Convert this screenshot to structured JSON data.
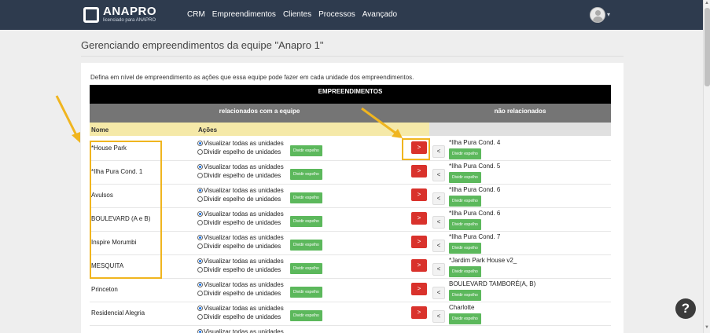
{
  "header": {
    "brand": "ANAPRO",
    "brand_sub": "licenciado para ANAPRO",
    "nav": [
      "CRM",
      "Empreendimentos",
      "Clientes",
      "Processos",
      "Avançado"
    ]
  },
  "page": {
    "title": "Gerenciando empreendimentos da equipe \"Anapro 1\"",
    "description": "Defina em nível de empreendimento as ações que essa equipe pode fazer em cada unidade dos empreendimentos."
  },
  "table": {
    "header_main": "EMPREENDIMENTOS",
    "header_left": "relacionados com a equipe",
    "header_right": "não relacionados",
    "col_nome": "Nome",
    "col_acoes": "Ações",
    "option_all": "Visualizar todas as unidades",
    "option_mirror": "Dividir espelho de unidades",
    "split_label": "Dividir espelho",
    "move_right": ">",
    "move_left": "<",
    "rows": [
      {
        "name": "*House Park",
        "right": "*Ilha Pura Cond. 4"
      },
      {
        "name": "*Ilha Pura Cond. 1",
        "right": "*Ilha Pura Cond. 5"
      },
      {
        "name": "Avulsos",
        "right": "*Ilha Pura Cond. 6"
      },
      {
        "name": "BOULEVARD (A e B)",
        "right": "*Ilha Pura Cond. 6"
      },
      {
        "name": "Inspire Morumbi",
        "right": "*Ilha Pura Cond. 7"
      },
      {
        "name": "MESQUITA",
        "right": "*Jardim Park House v2_"
      },
      {
        "name": "Princeton",
        "right": "BOULEVARD TAMBORÉ(A, B)"
      },
      {
        "name": "Residencial Alegria",
        "right": "Charlotte"
      },
      {
        "name": "",
        "right": ""
      }
    ]
  },
  "help": "?",
  "colors": {
    "topbar": "#2e3b4e",
    "red": "#d9322c",
    "green": "#5cb85c",
    "highlight": "#f0b51f",
    "yellow_header": "#f5e9a8"
  }
}
